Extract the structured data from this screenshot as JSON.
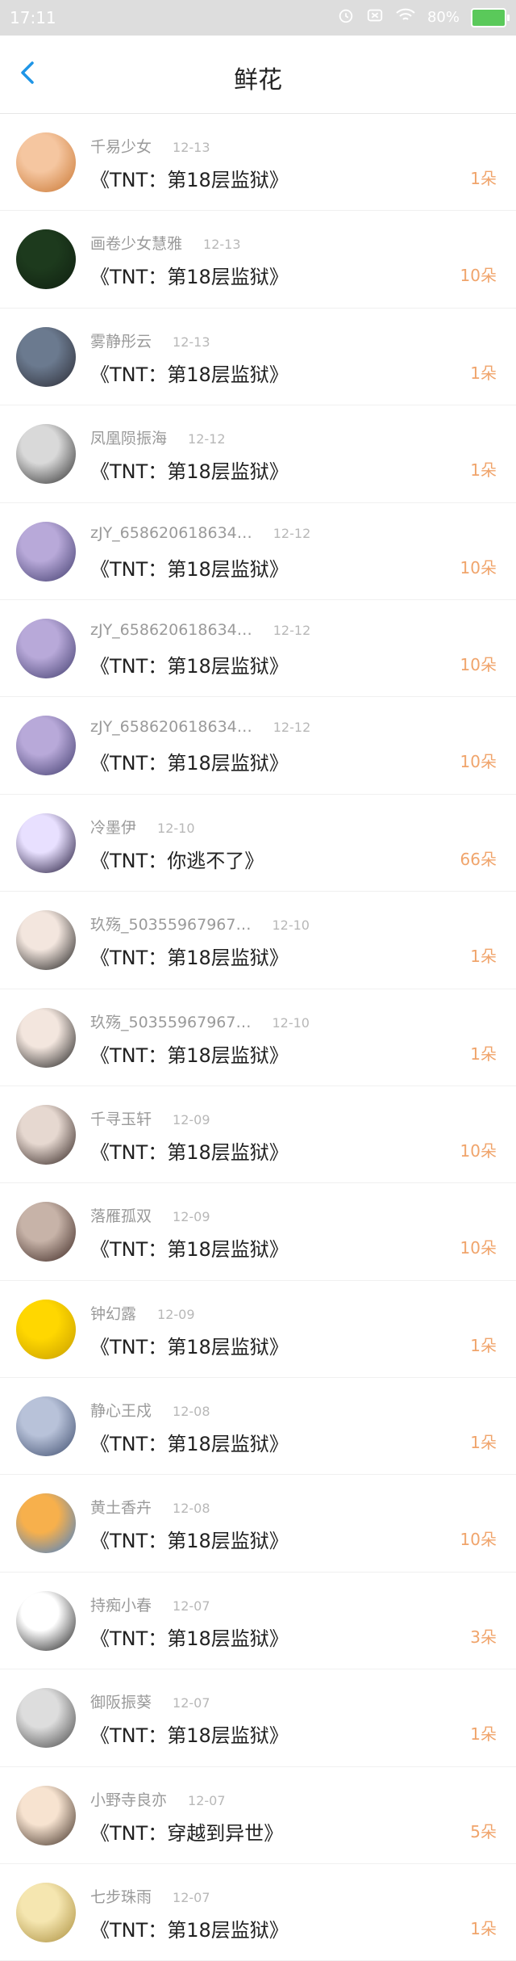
{
  "status_bar": {
    "time": "17:11",
    "battery": "80%"
  },
  "header": {
    "title": "鲜花"
  },
  "icons": {
    "back": "chevron-left-icon",
    "alarm": "alarm-icon",
    "mute": "mute-icon",
    "wifi": "wifi-icon",
    "battery": "battery-icon"
  },
  "colors": {
    "accent": "#1e95e6",
    "count": "#f0a46b",
    "name": "#9a9a9a",
    "work": "#222222"
  },
  "gifts": [
    {
      "user": "千易少女",
      "date": "12-13",
      "work": "《TNT：第18层监狱》",
      "count": "1朵"
    },
    {
      "user": "画卷少女慧雅",
      "date": "12-13",
      "work": "《TNT：第18层监狱》",
      "count": "10朵"
    },
    {
      "user": "雾静彤云",
      "date": "12-13",
      "work": "《TNT：第18层监狱》",
      "count": "1朵"
    },
    {
      "user": "凤凰陨振海",
      "date": "12-12",
      "work": "《TNT：第18层监狱》",
      "count": "1朵"
    },
    {
      "user": "zJY_658620618634…",
      "date": "12-12",
      "work": "《TNT：第18层监狱》",
      "count": "10朵"
    },
    {
      "user": "zJY_658620618634…",
      "date": "12-12",
      "work": "《TNT：第18层监狱》",
      "count": "10朵"
    },
    {
      "user": "zJY_658620618634…",
      "date": "12-12",
      "work": "《TNT：第18层监狱》",
      "count": "10朵"
    },
    {
      "user": "冷墨伊",
      "date": "12-10",
      "work": "《TNT：你逃不了》",
      "count": "66朵"
    },
    {
      "user": "玖殇_50355967967…",
      "date": "12-10",
      "work": "《TNT：第18层监狱》",
      "count": "1朵"
    },
    {
      "user": "玖殇_50355967967…",
      "date": "12-10",
      "work": "《TNT：第18层监狱》",
      "count": "1朵"
    },
    {
      "user": "千寻玉轩",
      "date": "12-09",
      "work": "《TNT：第18层监狱》",
      "count": "10朵"
    },
    {
      "user": "落雁孤双",
      "date": "12-09",
      "work": "《TNT：第18层监狱》",
      "count": "10朵"
    },
    {
      "user": "钟幻露",
      "date": "12-09",
      "work": "《TNT：第18层监狱》",
      "count": "1朵"
    },
    {
      "user": "静心王戍",
      "date": "12-08",
      "work": "《TNT：第18层监狱》",
      "count": "1朵"
    },
    {
      "user": "黄土香卉",
      "date": "12-08",
      "work": "《TNT：第18层监狱》",
      "count": "10朵"
    },
    {
      "user": "持痴小春",
      "date": "12-07",
      "work": "《TNT：第18层监狱》",
      "count": "3朵"
    },
    {
      "user": "御阪振葵",
      "date": "12-07",
      "work": "《TNT：第18层监狱》",
      "count": "1朵"
    },
    {
      "user": "小野寺良亦",
      "date": "12-07",
      "work": "《TNT：穿越到异世》",
      "count": "5朵"
    },
    {
      "user": "七步珠雨",
      "date": "12-07",
      "work": "《TNT：第18层监狱》",
      "count": "1朵"
    }
  ]
}
